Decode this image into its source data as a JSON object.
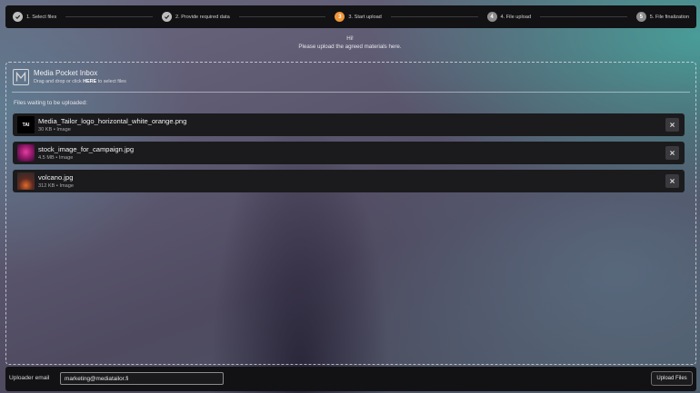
{
  "stepper": {
    "steps": [
      {
        "label": "1. Select files",
        "state": "done",
        "icon": "check-icon"
      },
      {
        "label": "2. Provide required data",
        "state": "done",
        "icon": "check-icon"
      },
      {
        "label": "3. Start upload",
        "state": "active",
        "number": "3"
      },
      {
        "label": "4. File upload",
        "state": "pending",
        "number": "4"
      },
      {
        "label": "5. File finalization",
        "state": "pending",
        "number": "5"
      }
    ],
    "colors": {
      "done": "#bdbdbd",
      "active": "#f0953a",
      "pending": "#8d8d8d"
    }
  },
  "greeting": {
    "line1": "Hi!",
    "line2": "Please upload the agreed materials here."
  },
  "inbox": {
    "logo_icon": "media-pocket-logo-icon",
    "title": "Media Pocket Inbox",
    "hint_before": "Drag and drop or click ",
    "hint_link": "HERE",
    "hint_after": " to select files"
  },
  "files": {
    "heading": "Files waiting to be uploaded:",
    "items": [
      {
        "name": "Media_Tailor_logo_horizontal_white_orange.png",
        "size": "30 KB",
        "separator": "•",
        "type": "Image",
        "thumb_text": "TAI"
      },
      {
        "name": "stock_image_for_campaign.jpg",
        "size": "4.5 MB",
        "separator": "•",
        "type": "Image"
      },
      {
        "name": "volcano.jpg",
        "size": "312 KB",
        "separator": "•",
        "type": "Image"
      }
    ],
    "remove_icon": "close-icon"
  },
  "footer": {
    "email_label": "Uploader email",
    "email_value": "marketing@mediatailor.fi",
    "upload_label": "Upload Files"
  }
}
